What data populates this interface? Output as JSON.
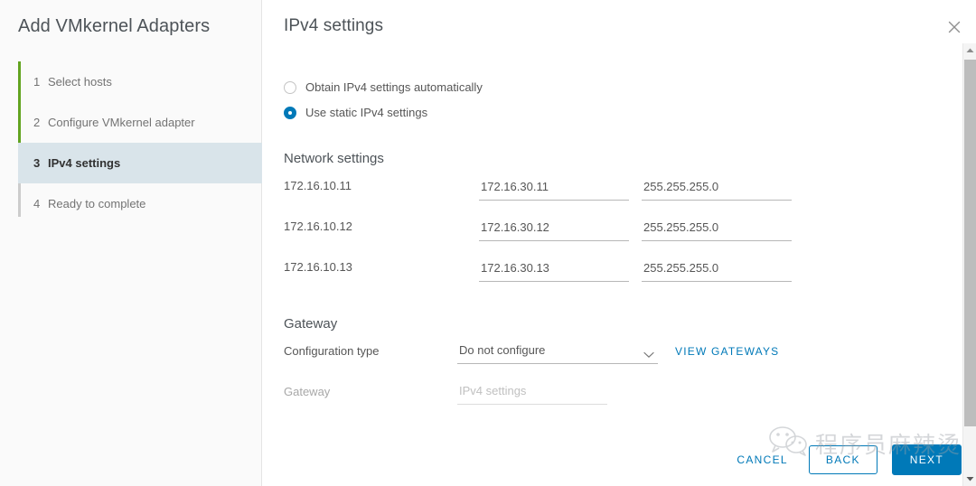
{
  "wizard": {
    "title": "Add VMkernel Adapters",
    "close_icon": "close-icon"
  },
  "sidebar": {
    "steps": [
      {
        "num": "1",
        "label": "Select hosts",
        "state": "completed"
      },
      {
        "num": "2",
        "label": "Configure VMkernel adapter",
        "state": "completed"
      },
      {
        "num": "3",
        "label": "IPv4 settings",
        "state": "active"
      },
      {
        "num": "4",
        "label": "Ready to complete",
        "state": "upcoming"
      }
    ],
    "rail_color": "#62a420",
    "active_bg": "#d9e4ea"
  },
  "page": {
    "title": "IPv4 settings"
  },
  "ip_mode": {
    "options": [
      {
        "label": "Obtain IPv4 settings automatically",
        "selected": false
      },
      {
        "label": "Use static IPv4 settings",
        "selected": true
      }
    ],
    "selected_color": "#0079b8"
  },
  "network_settings": {
    "heading": "Network settings",
    "rows": [
      {
        "host": "172.16.10.11",
        "ip": "172.16.30.11",
        "mask": "255.255.255.0"
      },
      {
        "host": "172.16.10.12",
        "ip": "172.16.30.12",
        "mask": "255.255.255.0"
      },
      {
        "host": "172.16.10.13",
        "ip": "172.16.30.13",
        "mask": "255.255.255.0"
      }
    ]
  },
  "gateway": {
    "heading": "Gateway",
    "config_type_label": "Configuration type",
    "config_type_value": "Do not configure",
    "config_type_options": [
      "Do not configure"
    ],
    "view_gateways_link": "VIEW GATEWAYS",
    "gateway_label": "Gateway",
    "gateway_value": "",
    "gateway_placeholder": "IPv4 settings",
    "chevron_icon": "chevron-down-icon"
  },
  "footer": {
    "cancel": "CANCEL",
    "back": "BACK",
    "next": "NEXT",
    "primary_color": "#0079b8"
  },
  "watermark": {
    "text": "程序员麻辣烫",
    "logo_icon": "wechat-icon"
  },
  "scrollbar": {
    "up_icon": "scroll-up-arrow-icon",
    "down_icon": "scroll-down-arrow-icon"
  }
}
